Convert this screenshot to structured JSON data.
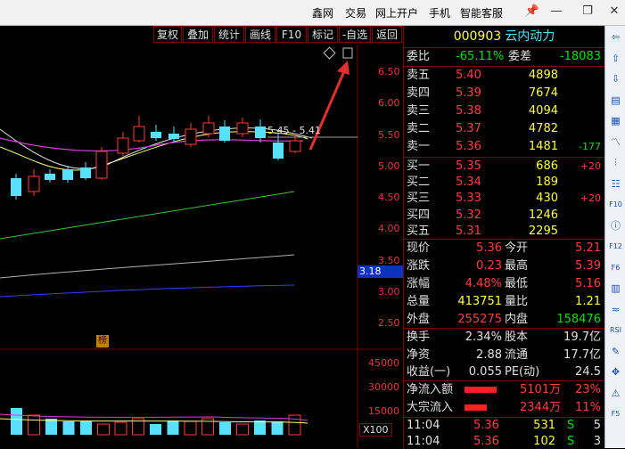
{
  "menu": {
    "items": [
      "鑫网",
      "交易",
      "网上开户",
      "手机",
      "智能客服"
    ],
    "pin": "📌",
    "minimize": "—",
    "maximize": "❐",
    "close": "✕"
  },
  "toolbar": {
    "buttons": [
      "复权",
      "叠加",
      "统计",
      "画线",
      "F10",
      "标记",
      "-自选",
      "返回"
    ]
  },
  "chart": {
    "price_ticks": [
      "6.50",
      "6.00",
      "5.50",
      "5.00",
      "4.50",
      "4.00",
      "3.50",
      "3.00",
      "2.50"
    ],
    "current_price_marker": "3.18",
    "range_label": "5.45 - 5.41",
    "badge": "榜",
    "volume_ticks": [
      "45000",
      "30000",
      "15000"
    ],
    "volume_unit": "X100"
  },
  "stock": {
    "code": "000903",
    "name": "云内动力",
    "weibi_label": "委比",
    "weibi_value": "-65.11%",
    "weicha_label": "委差",
    "weicha_value": "-18083",
    "asks": [
      {
        "label": "卖五",
        "price": "5.40",
        "vol": "4898",
        "chg": ""
      },
      {
        "label": "卖四",
        "price": "5.39",
        "vol": "7674",
        "chg": ""
      },
      {
        "label": "卖三",
        "price": "5.38",
        "vol": "4094",
        "chg": ""
      },
      {
        "label": "卖二",
        "price": "5.37",
        "vol": "4782",
        "chg": ""
      },
      {
        "label": "卖一",
        "price": "5.36",
        "vol": "1481",
        "chg": "-177"
      }
    ],
    "bids": [
      {
        "label": "买一",
        "price": "5.35",
        "vol": "686",
        "chg": "+20"
      },
      {
        "label": "买二",
        "price": "5.34",
        "vol": "189",
        "chg": ""
      },
      {
        "label": "买三",
        "price": "5.33",
        "vol": "430",
        "chg": "+20"
      },
      {
        "label": "买四",
        "price": "5.32",
        "vol": "1246",
        "chg": ""
      },
      {
        "label": "买五",
        "price": "5.31",
        "vol": "2295",
        "chg": ""
      }
    ],
    "stats": [
      {
        "l1": "现价",
        "v1": "5.36",
        "l2": "今开",
        "v2": "5.21"
      },
      {
        "l1": "涨跌",
        "v1": "0.23",
        "l2": "最高",
        "v2": "5.39"
      },
      {
        "l1": "涨幅",
        "v1": "4.48%",
        "l2": "最低",
        "v2": "5.16"
      },
      {
        "l1": "总量",
        "v1": "413751",
        "l2": "量比",
        "v2": "1.21"
      },
      {
        "l1": "外盘",
        "v1": "255275",
        "l2": "内盘",
        "v2": "158476"
      }
    ],
    "stats2": [
      {
        "l1": "换手",
        "v1": "2.34%",
        "l2": "股本",
        "v2": "19.7亿"
      },
      {
        "l1": "净资",
        "v1": "2.88",
        "l2": "流通",
        "v2": "17.7亿"
      },
      {
        "l1": "收益(一)",
        "v1": "0.055",
        "l2": "PE(动)",
        "v2": "24.5"
      }
    ],
    "flows": [
      {
        "label": "净流入额",
        "amount": "5101万",
        "pct": "23%",
        "fill": 0.85
      },
      {
        "label": "大宗流入",
        "amount": "2344万",
        "pct": "11%",
        "fill": 0.6
      }
    ],
    "ticks": [
      {
        "time": "11:04",
        "price": "5.36",
        "vol": "531",
        "side": "S",
        "n": "5"
      },
      {
        "time": "11:04",
        "price": "5.36",
        "vol": "102",
        "side": "S",
        "n": "3"
      }
    ]
  },
  "sidebar": {
    "icons": [
      "arrow-left-icon",
      "arrow-up-icon",
      "arrow-down-icon",
      "report-icon",
      "table-icon",
      "line-chart-icon",
      "kline-icon",
      "list-icon",
      "f10-icon",
      "info-icon",
      "f12-icon",
      "f6-icon",
      "grid-icon",
      "wave-icon",
      "rsi-icon",
      "brush-icon",
      "move-icon",
      "warning-icon",
      "f5-icon"
    ],
    "glyphs": [
      "⇦",
      "⇧",
      "⇩",
      "▤",
      "▦",
      "〽",
      "⫶",
      "☷",
      "F10",
      "ⓘ",
      "F12",
      "F6",
      "▥",
      "≈",
      "RSI",
      "✎",
      "✥",
      "⚠",
      "F5"
    ]
  },
  "colors": {
    "up": "#ff4040",
    "down": "#5ae0ff",
    "border": "#800000",
    "code": "#ffff40",
    "name": "#5ae0ff"
  }
}
